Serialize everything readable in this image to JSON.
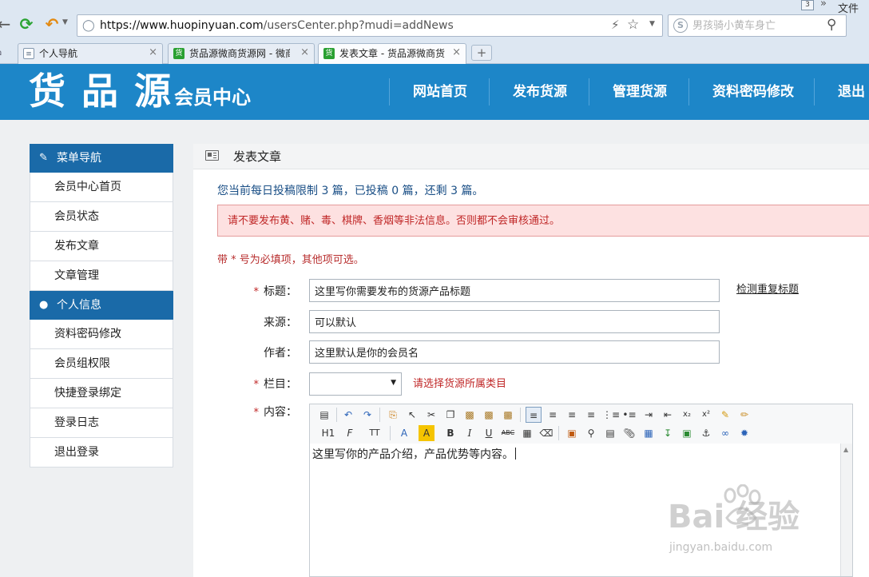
{
  "browser": {
    "url_domain": "https://www.huopinyuan.com",
    "url_path": "/usersCenter.php?mudi=addNews",
    "search_placeholder": "男孩骑小黄车身亡",
    "window_count": "3",
    "more_glyph": "»",
    "file_menu": "文件",
    "tabs": [
      {
        "label": "个人导航",
        "favicon": "page"
      },
      {
        "label": "货品源微商货源网 - 微商",
        "favicon": "货"
      },
      {
        "label": "发表文章 - 货品源微商货",
        "favicon": "货",
        "active": true
      }
    ],
    "new_tab_glyph": "+"
  },
  "site": {
    "logo": "货品源",
    "logo_sub": "会员中心",
    "nav": [
      "网站首页",
      "发布货源",
      "管理货源",
      "资料密码修改",
      "退出"
    ],
    "header_color": "#1d86c8"
  },
  "sidebar": {
    "sections": [
      {
        "title": "菜单导航",
        "icon": "pencil-icon",
        "items": [
          "会员中心首页",
          "会员状态",
          "发布文章",
          "文章管理"
        ]
      },
      {
        "title": "个人信息",
        "icon": "user-icon",
        "items": [
          "资料密码修改",
          "会员组权限",
          "快捷登录绑定",
          "登录日志",
          "退出登录"
        ]
      }
    ]
  },
  "main": {
    "title": "发表文章",
    "quota": "您当前每日投稿限制 3 篇，已投稿 0 篇，还剩 3 篇。",
    "warning": "请不要发布黄、赌、毒、棋牌、香烟等非法信息。否则都不会审核通过。",
    "required_note": "带 * 号为必填项，其他项可选。",
    "form": {
      "title_label": "标题：",
      "title_value": "这里写你需要发布的货源产品标题",
      "dup_link": "检测重复标题",
      "source_label": "来源：",
      "source_value": "可以默认",
      "author_label": "作者：",
      "author_value": "这里默认是你的会员名",
      "category_label": "栏目：",
      "category_value": "",
      "category_hint": "请选择货源所属类目",
      "content_label": "内容：",
      "required_mark": "*"
    },
    "editor": {
      "content": "这里写你的产品介绍，产品优势等内容。",
      "toolbar_row1": [
        "source-icon",
        "undo-icon",
        "redo-icon",
        "insert-code-icon",
        "select-icon",
        "cut-icon",
        "copy-icon",
        "paste-icon",
        "paste-text-icon",
        "paste-word-icon",
        "align-left-icon",
        "align-center-icon",
        "align-right-icon",
        "justify-icon",
        "ordered-list-icon",
        "unordered-list-icon",
        "indent-icon",
        "outdent-icon",
        "subscript-icon",
        "superscript-icon",
        "clear-format-icon",
        "format-brush-icon"
      ],
      "toolbar_row2_text": {
        "heading": "H1",
        "font": "F",
        "size": "TT",
        "font_color": "A",
        "bg_color": "A",
        "bold": "B",
        "italic": "I",
        "underline": "U",
        "strike": "ABC",
        "sub": "x₂",
        "sup": "x²"
      }
    }
  },
  "watermark": {
    "logo": "Bai  经验",
    "url": "jingyan.baidu.com"
  }
}
